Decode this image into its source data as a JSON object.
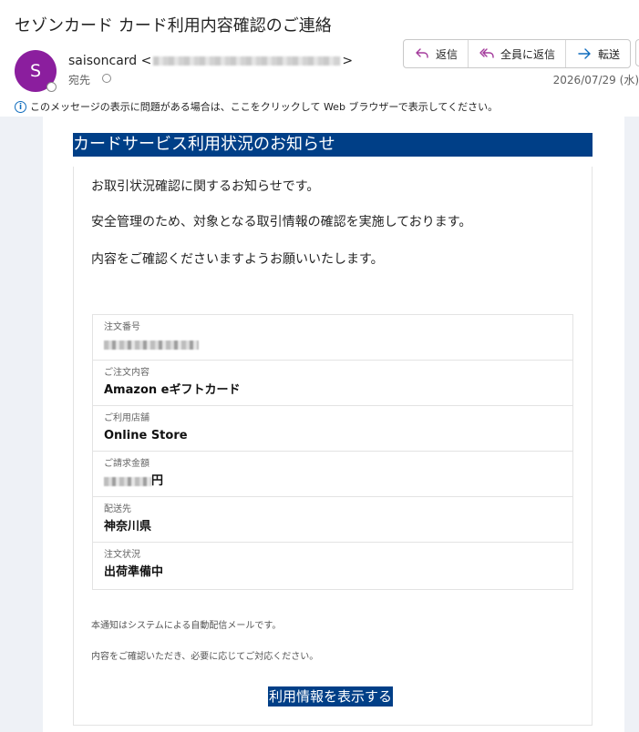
{
  "header": {
    "subject": "セゾンカード カード利用内容確認のご連絡",
    "avatar_initial": "S",
    "sender_name": "saisoncard",
    "sender_open": "<",
    "sender_close": ">",
    "to_label": "宛先",
    "date": "2026/07/29 (水)"
  },
  "actions": {
    "reply": "返信",
    "reply_all": "全員に返信",
    "forward": "転送"
  },
  "info_bar": {
    "text": "このメッセージの表示に問題がある場合は、ここをクリックして Web ブラウザーで表示してください。"
  },
  "email": {
    "banner_title": "カードサービス利用状況のお知らせ",
    "paragraphs": [
      "お取引状況確認に関するお知らせです。",
      "安全管理のため、対象となる取引情報の確認を実施しております。",
      "内容をご確認くださいますようお願いいたします。"
    ],
    "details": [
      {
        "label": "注文番号",
        "value": ""
      },
      {
        "label": "ご注文内容",
        "value": "Amazon eギフトカード"
      },
      {
        "label": "ご利用店舗",
        "value": "Online Store"
      },
      {
        "label": "ご請求金額",
        "value": "円"
      },
      {
        "label": "配送先",
        "value": "神奈川県"
      },
      {
        "label": "注文状況",
        "value": "出荷準備中"
      }
    ],
    "note_1": "本通知はシステムによる自動配信メールです。",
    "note_2": "内容をご確認いただき、必要に応じてご対応ください。",
    "cta_label": "利用情報を表示する"
  },
  "colors": {
    "banner_bg": "#003f87",
    "avatar_bg": "#8b1e9e",
    "accent": "#0f6cbd",
    "action_icon": "#a33a9b"
  }
}
